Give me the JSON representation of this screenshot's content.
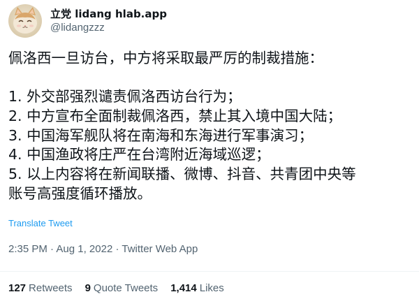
{
  "author": {
    "display_name": "立党 lidang hlab.app",
    "handle": "@lidangzzz",
    "avatar_icon": "cat-avatar-icon"
  },
  "tweet": {
    "lines": [
      "佩洛西一旦访台，中方将采取最严厉的制裁措施：",
      "",
      "1. 外交部强烈谴责佩洛西访台行为；",
      "2. 中方宣布全面制裁佩洛西，禁止其入境中国大陆；",
      "3. 中国海军舰队将在南海和东海进行军事演习；",
      "4. 中国渔政将庄严在台湾附近海域巡逻；",
      "5. 以上内容将在新闻联播、微博、抖音、共青团中央等",
      "账号高强度循环播放。"
    ],
    "translate_label": "Translate Tweet"
  },
  "meta": {
    "time": "2:35 PM",
    "sep1": " · ",
    "date": "Aug 1, 2022",
    "sep2": " · ",
    "source": "Twitter Web App"
  },
  "stats": {
    "retweets_count": "127",
    "retweets_label": "Retweets",
    "quotes_count": "9",
    "quotes_label": "Quote Tweets",
    "likes_count": "1,414",
    "likes_label": "Likes"
  },
  "colors": {
    "text": "#0f1419",
    "secondary": "#536471",
    "link": "#1d9bf0",
    "divider": "#eff3f4"
  }
}
